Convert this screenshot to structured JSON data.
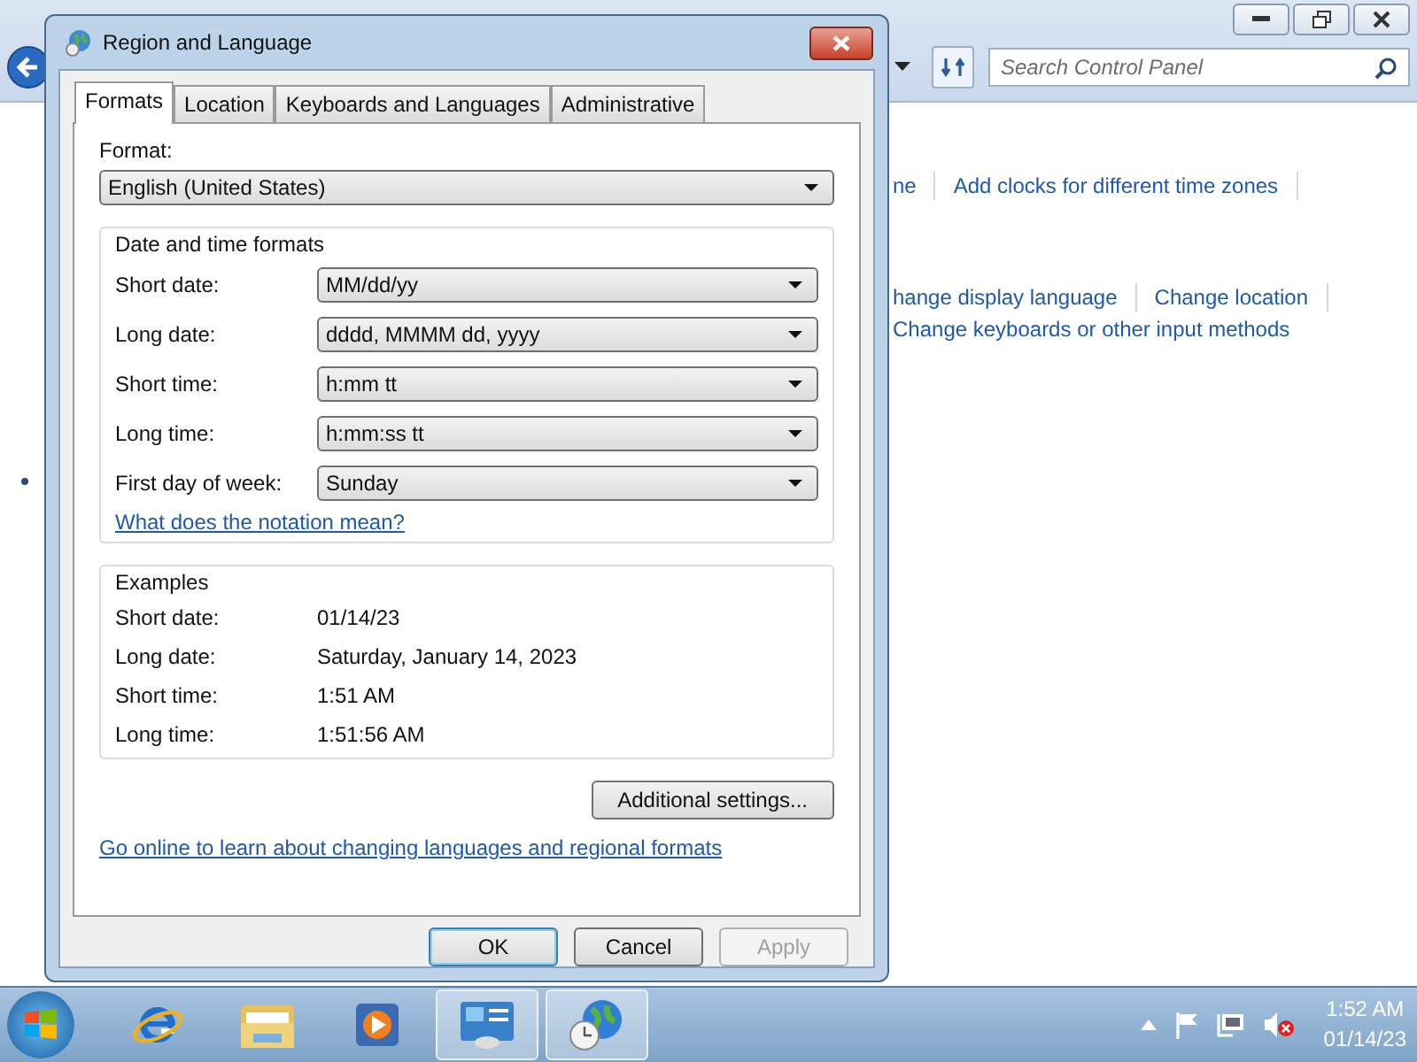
{
  "background_window": {
    "search": {
      "placeholder": "Search Control Panel"
    },
    "link_rows": [
      {
        "links": [
          "ne",
          "Add clocks for different time zones"
        ]
      },
      {
        "links": [
          "hange display language",
          "Change location"
        ]
      },
      {
        "links": [
          "Change keyboards or other input methods"
        ]
      }
    ]
  },
  "dialog": {
    "title": "Region and Language",
    "tabs": [
      {
        "label": "Formats",
        "selected": true
      },
      {
        "label": "Location",
        "selected": false
      },
      {
        "label": "Keyboards and Languages",
        "selected": false
      },
      {
        "label": "Administrative",
        "selected": false
      }
    ],
    "format_label": "Format:",
    "format_value": "English (United States)",
    "date_time_group": {
      "title": "Date and time formats",
      "fields": [
        {
          "label": "Short date:",
          "value": "MM/dd/yy"
        },
        {
          "label": "Long date:",
          "value": "dddd, MMMM dd, yyyy"
        },
        {
          "label": "Short time:",
          "value": "h:mm tt"
        },
        {
          "label": "Long time:",
          "value": "h:mm:ss tt"
        },
        {
          "label": "First day of week:",
          "value": "Sunday"
        }
      ],
      "link": "What does the notation mean?"
    },
    "examples_group": {
      "title": "Examples",
      "rows": [
        {
          "label": "Short date:",
          "value": "01/14/23"
        },
        {
          "label": "Long date:",
          "value": "Saturday, January 14, 2023"
        },
        {
          "label": "Short time:",
          "value": "1:51 AM"
        },
        {
          "label": "Long time:",
          "value": "1:51:56 AM"
        }
      ]
    },
    "additional_button": "Additional settings...",
    "online_link": "Go online to learn about changing languages and regional formats",
    "buttons": [
      {
        "label": "OK",
        "disabled": false,
        "default": true
      },
      {
        "label": "Cancel",
        "disabled": false,
        "default": false
      },
      {
        "label": "Apply",
        "disabled": true,
        "default": false
      }
    ]
  },
  "taskbar": {
    "items": [
      {
        "kind": "browser",
        "selected": false
      },
      {
        "kind": "folder",
        "selected": false
      },
      {
        "kind": "media",
        "selected": false
      },
      {
        "kind": "panel",
        "selected": true
      },
      {
        "kind": "globe",
        "selected": true
      }
    ],
    "time": "1:52 AM",
    "date": "01/14/23"
  }
}
